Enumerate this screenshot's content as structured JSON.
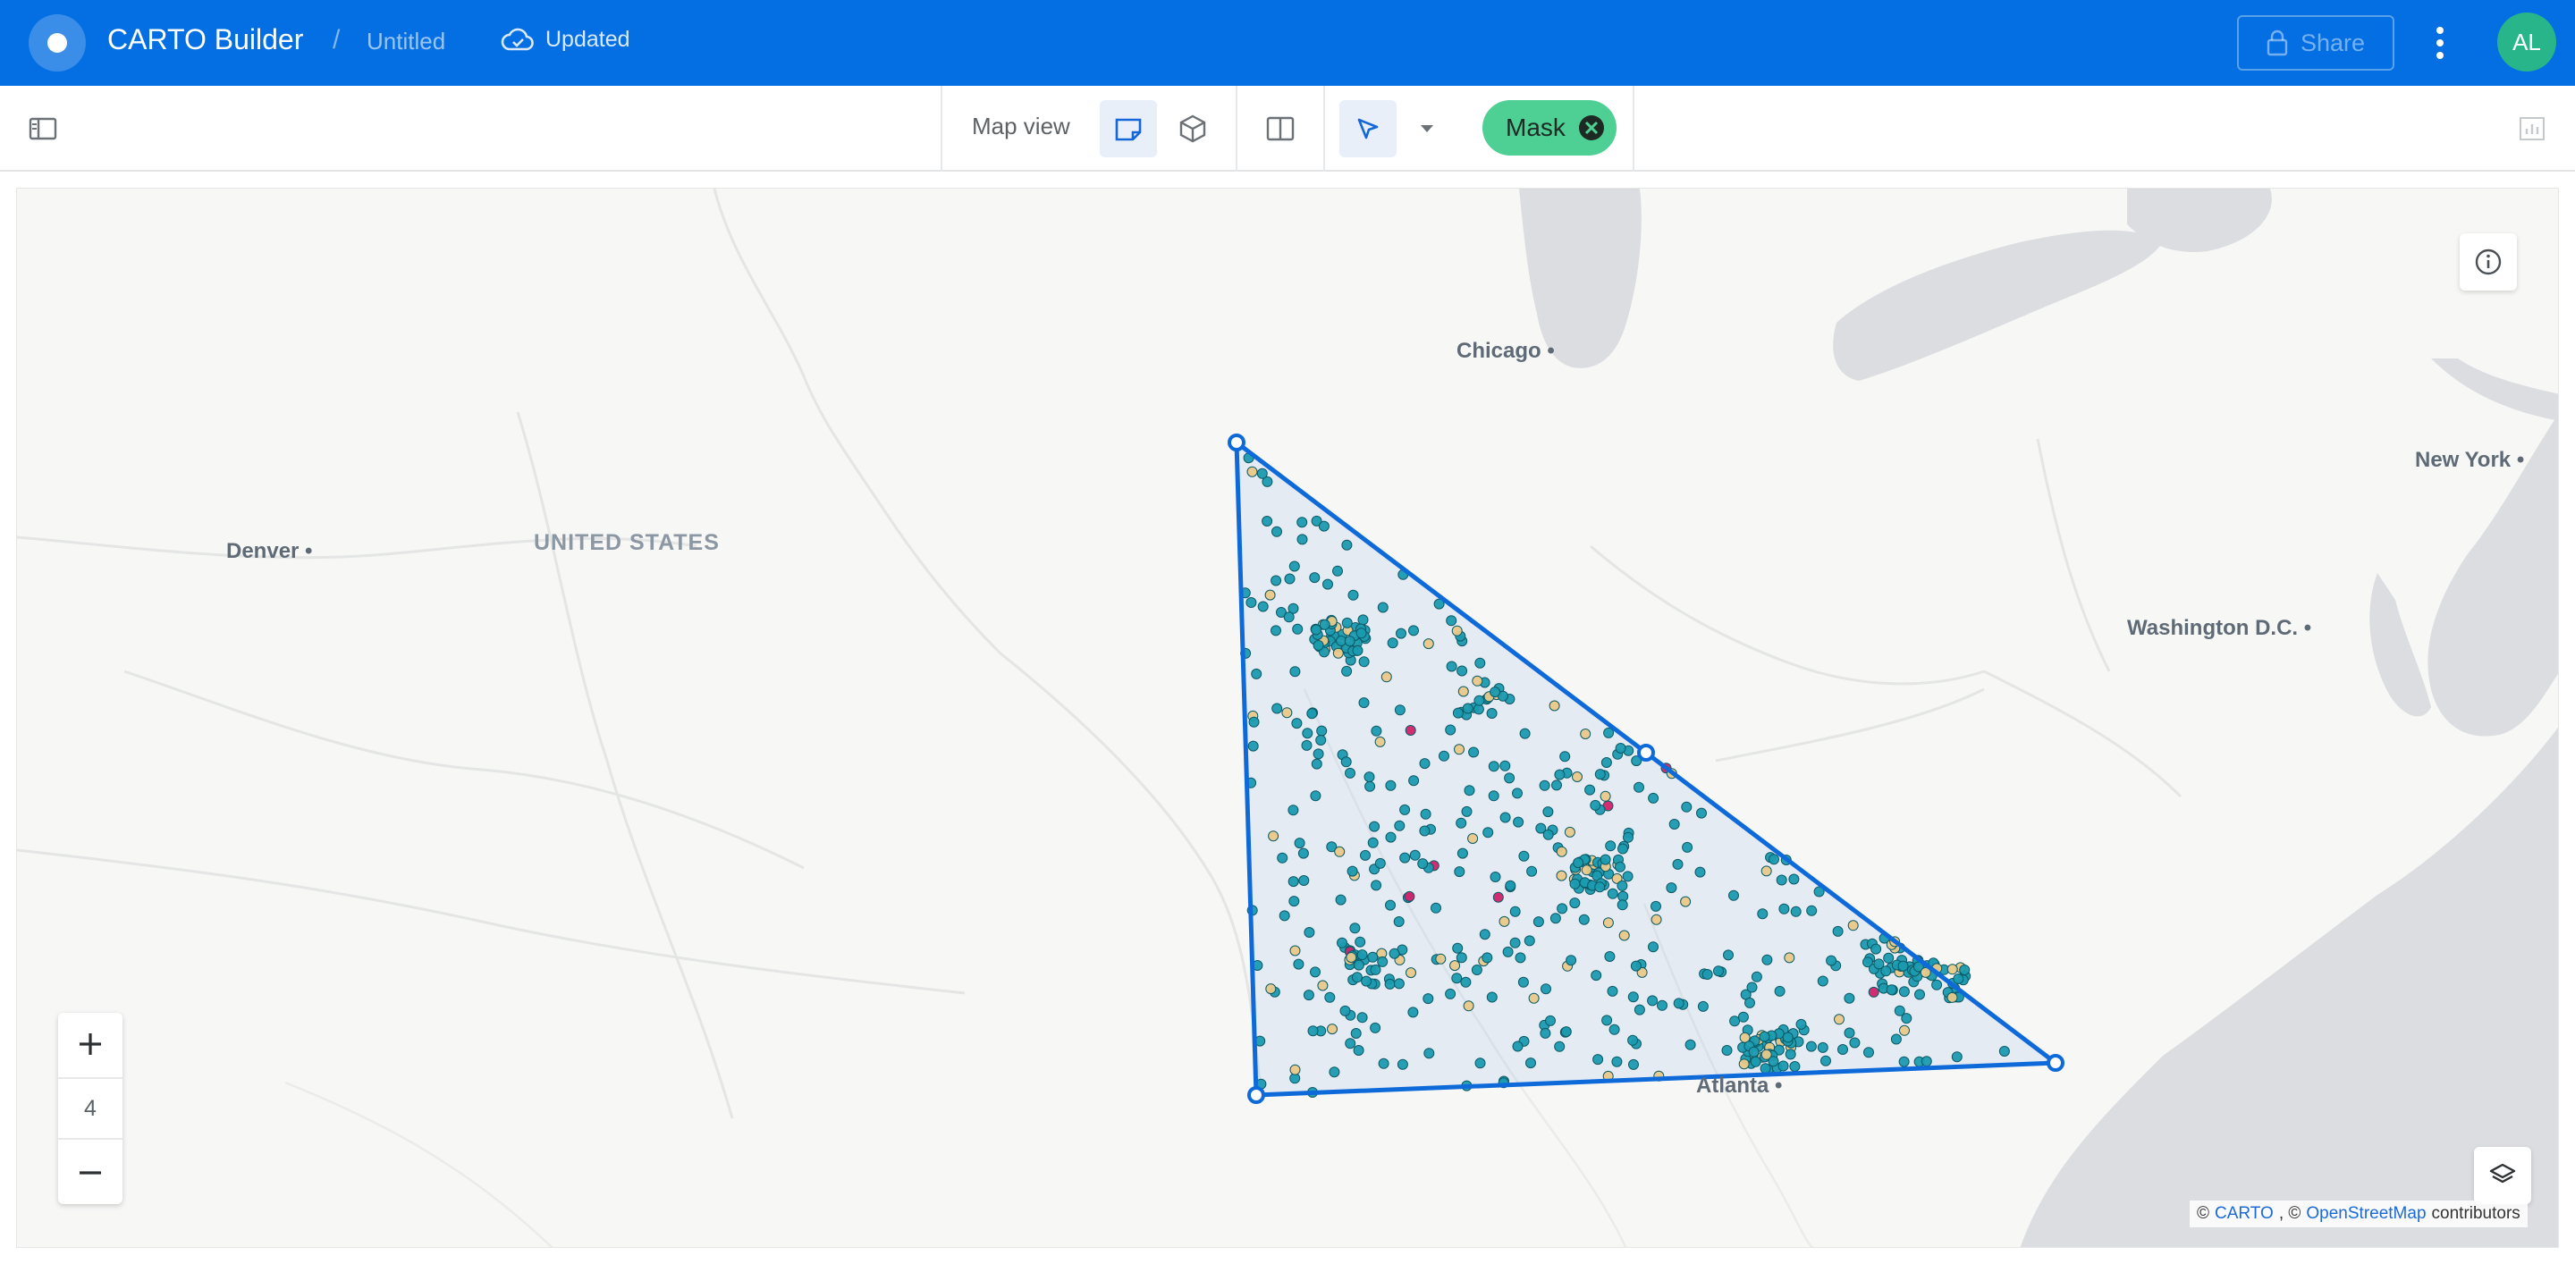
{
  "header": {
    "app_title": "CARTO Builder",
    "separator": "/",
    "map_name": "Untitled",
    "save_status": "Updated",
    "share_label": "Share",
    "avatar_initials": "AL",
    "bar_color": "#036fe2"
  },
  "toolbar": {
    "panel_toggle_icon": "sidebar-panel-icon",
    "map_view_label": "Map view",
    "view_2d_icon": "map-2d-icon",
    "view_3d_icon": "cube-3d-icon",
    "split_view_icon": "split-view-icon",
    "select_tool_icon": "cursor-arrow-icon",
    "mask_label": "Mask",
    "mask_color": "#4ecf94",
    "widgets_icon": "chart-bars-icon"
  },
  "map": {
    "cities": {
      "chicago": "Chicago",
      "new_york": "New York",
      "washington": "Washington D.C.",
      "denver": "Denver",
      "atlanta": "Atlanta"
    },
    "country_label": "UNITED STATES",
    "zoom_level": "4",
    "zoom_in_label": "+",
    "zoom_out_label": "−",
    "attribution": {
      "copy1": "©",
      "carto": "CARTO",
      "sep": ", ©",
      "osm": "OpenStreetMap",
      "suffix": "contributors"
    },
    "mask_polygon_color": "#0e6ad9",
    "point_colors": [
      "#1b9bb0",
      "#e9c989",
      "#d2236a"
    ]
  }
}
